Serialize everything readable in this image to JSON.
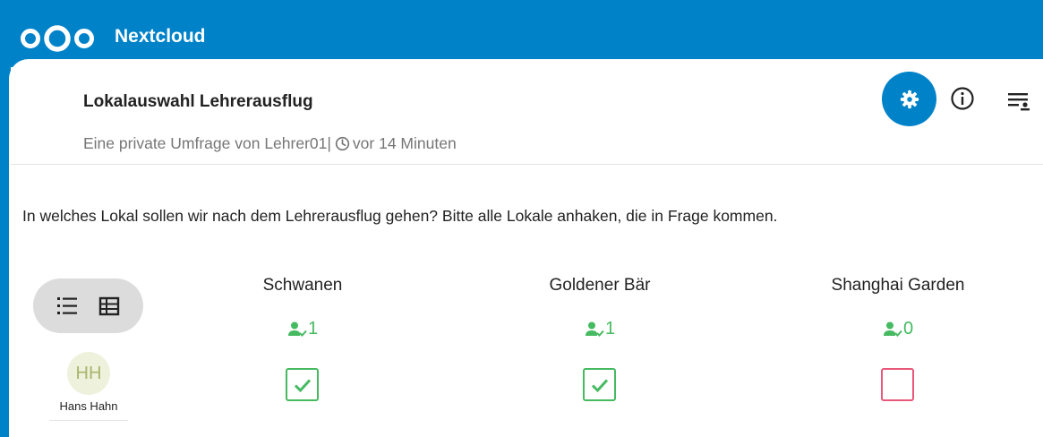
{
  "header": {
    "app_name": "Nextcloud",
    "logo_icon": "nextcloud-logo",
    "brand_color": "#0082c9"
  },
  "poll": {
    "title": "Lokalauswahl Lehrerausflug",
    "owner_text": "Eine private Umfrage von Lehrer01|",
    "time_text": "vor 14 Minuten",
    "description": "In welches Lokal sollen wir nach dem Lehrerausflug gehen? Bitte alle Lokale anhaken, die in Frage kommen."
  },
  "actions": {
    "settings_icon": "gear-icon",
    "info_icon": "info-icon",
    "menu_icon": "filter-list-icon"
  },
  "view_toggle": {
    "list_icon": "list-view-icon",
    "table_icon": "table-view-icon"
  },
  "participant": {
    "initials": "HH",
    "name": "Hans Hahn"
  },
  "options": [
    {
      "label": "Schwanen",
      "count": "1",
      "vote": "yes"
    },
    {
      "label": "Goldener Bär",
      "count": "1",
      "vote": "yes"
    },
    {
      "label": "Shanghai Garden",
      "count": "0",
      "vote": "no"
    }
  ],
  "colors": {
    "yes": "#46ba61",
    "no": "#e9587a"
  }
}
